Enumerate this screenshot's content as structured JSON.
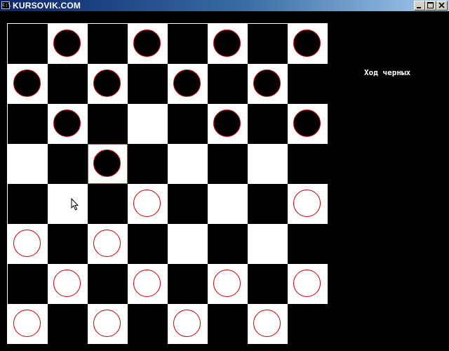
{
  "window": {
    "icon_text": "c:\\",
    "title": "KURSOVIK.COM",
    "buttons": [
      "minimize",
      "maximize",
      "close"
    ]
  },
  "game": {
    "status": "Ход черных",
    "selected_cell": "r3c2",
    "board": [
      [
        "",
        "b",
        "",
        "b",
        "",
        "b",
        "",
        "b"
      ],
      [
        "b",
        "",
        "b",
        "",
        "b",
        "",
        "b",
        ""
      ],
      [
        "",
        "b",
        "",
        "",
        "",
        "b",
        "",
        "b"
      ],
      [
        "",
        "",
        "b",
        "",
        "",
        "",
        "",
        ""
      ],
      [
        "",
        "",
        "",
        "w",
        "",
        "",
        "",
        "w"
      ],
      [
        "w",
        "",
        "w",
        "",
        "",
        "",
        "",
        ""
      ],
      [
        "",
        "w",
        "",
        "w",
        "",
        "w",
        "",
        "w"
      ],
      [
        "w",
        "",
        "w",
        "",
        "w",
        "",
        "w",
        ""
      ]
    ]
  },
  "colors": {
    "titlebar_start": "#0a246a",
    "titlebar_end": "#a6caf0",
    "piece_outline": "#c80000",
    "selection": "#2e9a2e",
    "background": "#000000"
  },
  "icons": {
    "window_icon": "console-icon",
    "cursor": "mouse-pointer-icon"
  }
}
